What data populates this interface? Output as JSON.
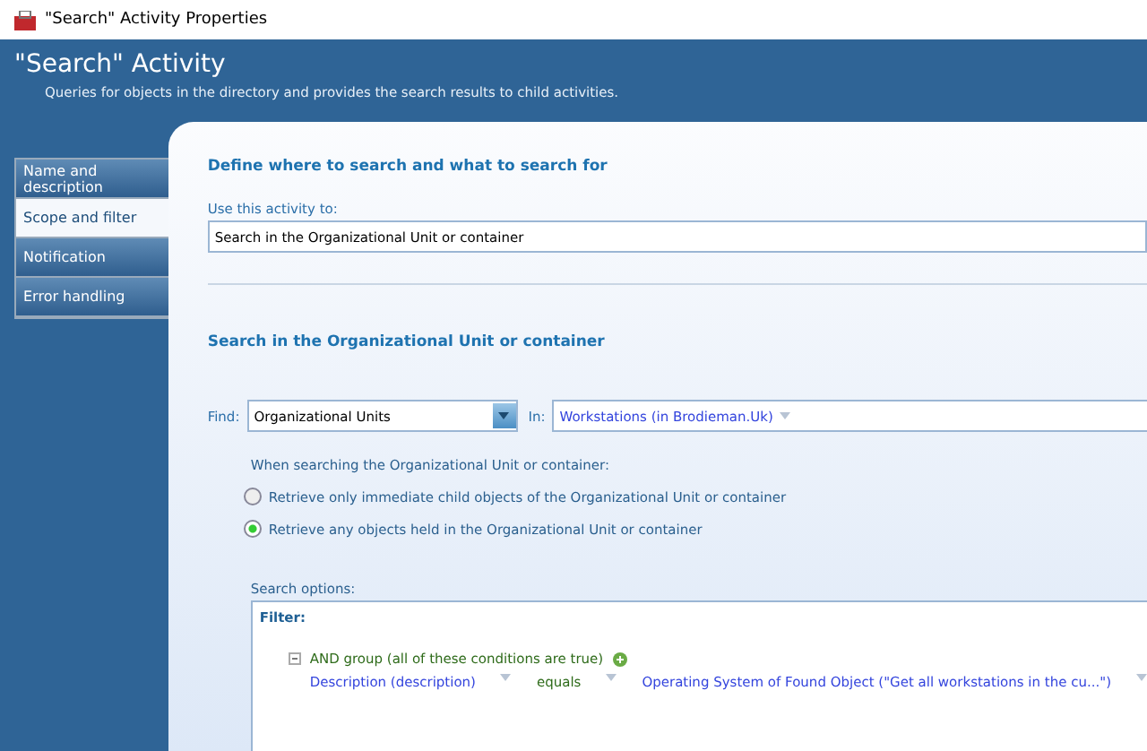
{
  "window": {
    "title": "\"Search\" Activity Properties"
  },
  "header": {
    "title": "\"Search\" Activity",
    "description": "Queries for objects in the directory and provides the search results to child activities."
  },
  "sidebar": {
    "items": [
      {
        "label": "Name and description",
        "selected": false
      },
      {
        "label": "Scope and filter",
        "selected": true
      },
      {
        "label": "Notification",
        "selected": false
      },
      {
        "label": "Error handling",
        "selected": false
      }
    ]
  },
  "content": {
    "heading": "Define where to search and what to search for",
    "use_label": "Use this activity to:",
    "use_value": "Search in the Organizational Unit or container",
    "section_heading": "Search in the Organizational Unit or container",
    "find_label": "Find:",
    "find_value": "Organizational Units",
    "in_label": "In:",
    "in_value": "Workstations (in Brodieman.Uk)",
    "scope_label": "When searching the Organizational Unit or container:",
    "radios": [
      {
        "label": "Retrieve only immediate child objects of the Organizational Unit or container",
        "selected": false
      },
      {
        "label": "Retrieve any objects held in the Organizational Unit or container",
        "selected": true
      }
    ],
    "options_label": "Search options:",
    "filter": {
      "title": "Filter:",
      "group": {
        "label": "AND group (all of these conditions are true)",
        "expanded": true
      },
      "condition": {
        "attribute": "Description (description)",
        "operator": "equals",
        "value": "Operating System of Found Object (\"Get all workstations in the cu...\")"
      }
    }
  }
}
